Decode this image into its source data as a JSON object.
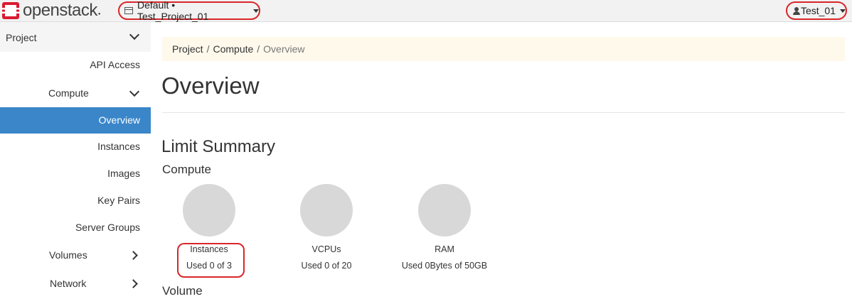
{
  "header": {
    "brand": "openstack",
    "project_label": "Default • Test_Project_01",
    "user_label": "Test_01"
  },
  "sidebar": {
    "header": "Project",
    "items": {
      "api_access": "API Access",
      "compute": "Compute",
      "overview": "Overview",
      "instances": "Instances",
      "images": "Images",
      "key_pairs": "Key Pairs",
      "server_groups": "Server Groups",
      "volumes": "Volumes",
      "network": "Network"
    }
  },
  "breadcrumb": {
    "project": "Project",
    "compute": "Compute",
    "current": "Overview",
    "separator": "/"
  },
  "page": {
    "title": "Overview",
    "limit_summary": "Limit Summary",
    "compute_heading": "Compute",
    "volume_heading": "Volume"
  },
  "limits": {
    "instances": {
      "name": "Instances",
      "usage": "Used 0 of 3"
    },
    "vcpus": {
      "name": "VCPUs",
      "usage": "Used 0 of 20"
    },
    "ram": {
      "name": "RAM",
      "usage": "Used 0Bytes of 50GB"
    }
  },
  "colors": {
    "accent": "#3a86c9",
    "highlight": "#d9262a",
    "brand_red": "#da1a32"
  }
}
